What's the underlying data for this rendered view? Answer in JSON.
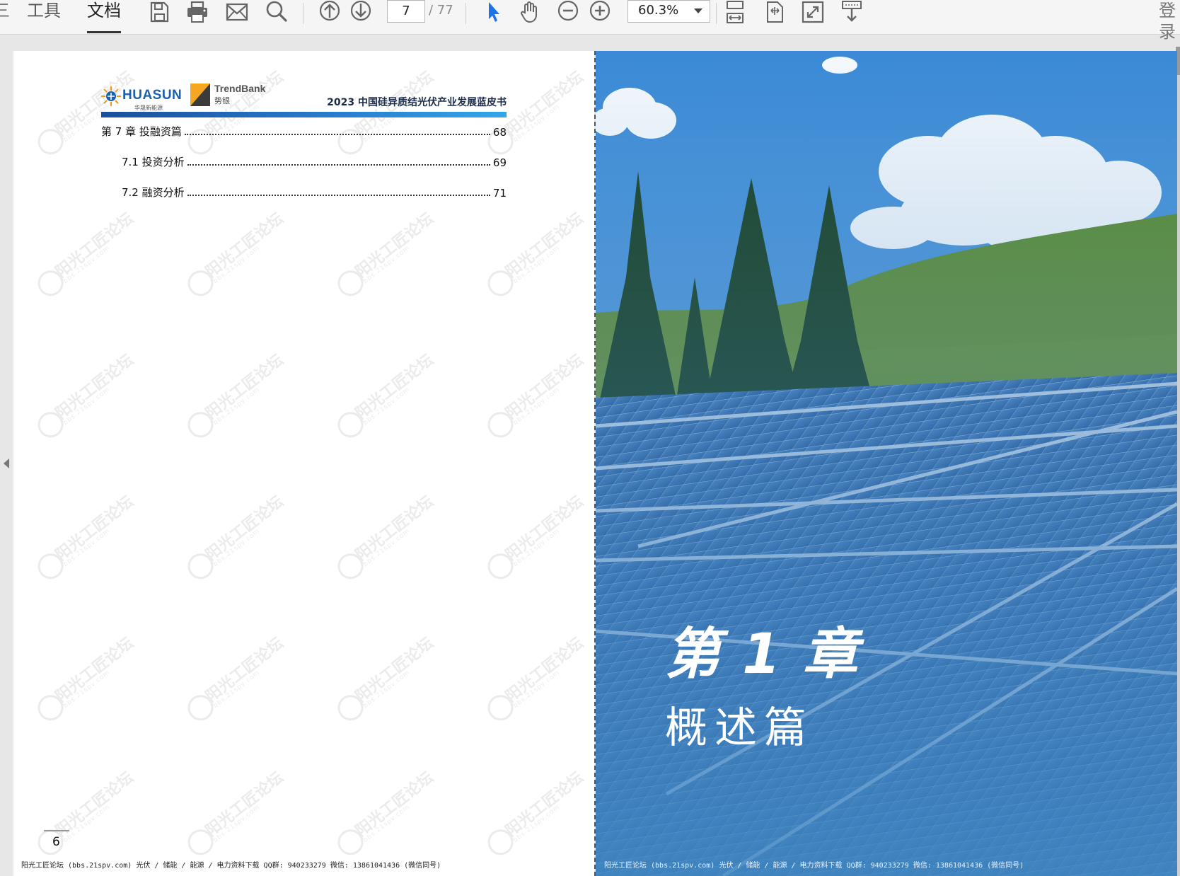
{
  "toolbar": {
    "left_edge_glyph": "三",
    "menu_tabs": [
      "工具",
      "文档"
    ],
    "active_tab": "文档",
    "current_page": "7",
    "total_pages": "/ 77",
    "zoom": "60.3%",
    "login_label": "登录",
    "icons": [
      "save-icon",
      "print-icon",
      "mail-icon",
      "search-icon",
      "page-up-icon",
      "page-down-icon",
      "select-cursor-icon",
      "hand-tool-icon",
      "zoom-out-icon",
      "zoom-in-icon",
      "fit-page-icon",
      "rotate-icon",
      "fullscreen-icon",
      "download-icon"
    ]
  },
  "left_page": {
    "logo_huasun_name": "HUASUN",
    "logo_huasun_sub": "华晟新能源",
    "logo_trend_en": "TrendBank",
    "logo_trend_cn": "势银",
    "doc_title": "2023 中国硅异质结光伏产业发展蓝皮书",
    "toc": [
      {
        "label": "第 7 章  投融资篇",
        "page": "68"
      },
      {
        "label": "7.1  投资分析",
        "page": "69"
      },
      {
        "label": "7.2  融资分析",
        "page": "71"
      }
    ],
    "page_number": "6",
    "footer": "阳光工匠论坛 (bbs.21spv.com)    光伏 / 储能 / 能源 / 电力资料下载   QQ群: 940233279    微信: 13861041436 (微信同号)",
    "watermark_text": "阳光工匠论坛",
    "watermark_sub": "bbs.21spv.com"
  },
  "right_page": {
    "chapter_number": "第 1 章",
    "chapter_title": "概述篇",
    "footer": "阳光工匠论坛 (bbs.21spv.com)    光伏 / 储能 / 能源 / 电力资料下载   QQ群: 940233279    微信: 13861041436 (微信同号)"
  },
  "colors": {
    "toolbar_bg": "#f5f5f5",
    "accent_blue": "#2a7ed1",
    "cursor_blue": "#1a73e8",
    "sky_top": "#3f8fd6",
    "panel_blue": "#3a78b8"
  }
}
